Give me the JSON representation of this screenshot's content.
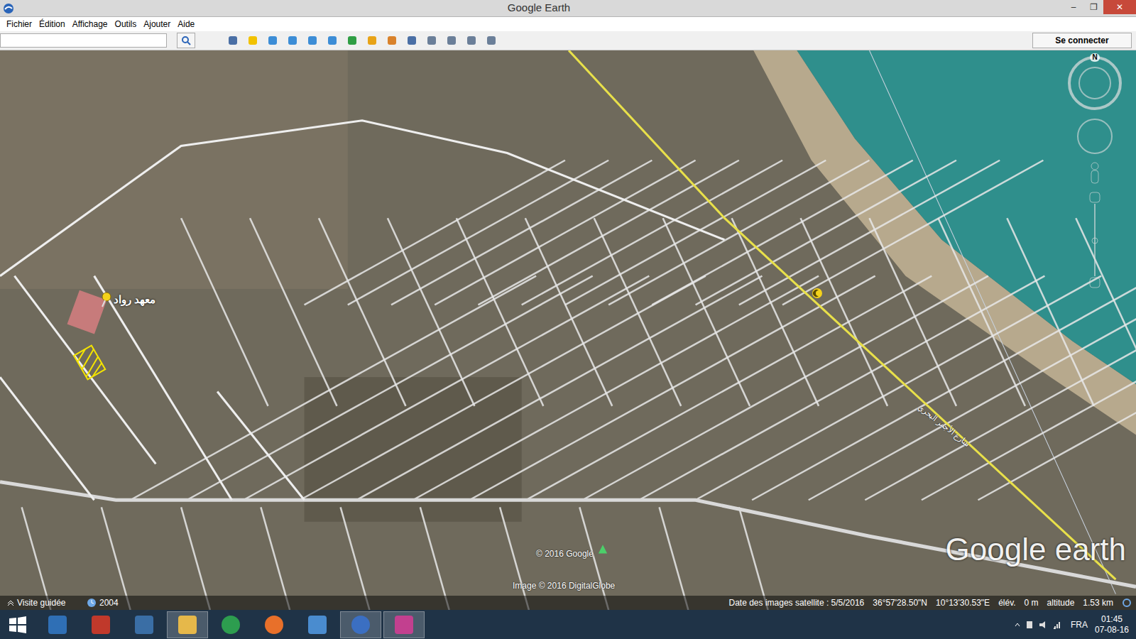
{
  "window": {
    "title": "Google Earth",
    "controls": [
      "–",
      "❐",
      "✕"
    ]
  },
  "menu": [
    "Fichier",
    "Édition",
    "Affichage",
    "Outils",
    "Ajouter",
    "Aide"
  ],
  "sign_in": "Se connecter",
  "map": {
    "placemark": "معهد رواد",
    "road_label": "شارع الأجمر البحري",
    "compass": "N",
    "copyright": "© 2016 Google",
    "imagery": "Image © 2016 DigitalGlobe",
    "watermark": "Google earth"
  },
  "tour": {
    "label": "Visite guidée",
    "year": "2004"
  },
  "status": {
    "date": "Date des images satellite : 5/5/2016",
    "lat": "36°57'28.50\"N",
    "lon": "10°13'30.53\"E",
    "elev_label": "élév.",
    "elev": "0 m",
    "alt_label": "altitude",
    "alt": "1.53 km"
  },
  "taskbar": {
    "apps": [
      {
        "active": false
      },
      {
        "active": false
      },
      {
        "active": false
      },
      {
        "active": true
      },
      {
        "active": false
      },
      {
        "active": false
      },
      {
        "active": false
      },
      {
        "active": true
      },
      {
        "active": true
      }
    ],
    "language": "FRA",
    "time": "01:45",
    "date": "07-08-16"
  }
}
